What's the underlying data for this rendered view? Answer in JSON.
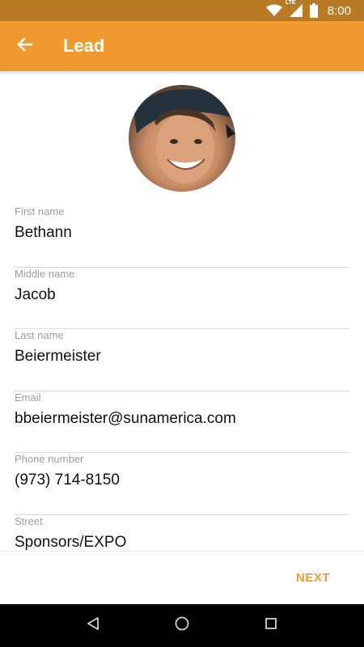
{
  "status_bar": {
    "time": "8:00",
    "network_label": "LTE",
    "icons": [
      "wifi-icon",
      "signal-icon",
      "battery-icon"
    ]
  },
  "app_bar": {
    "title": "Lead",
    "back_icon": "arrow-back-icon"
  },
  "avatar": {
    "icon": "profile-photo"
  },
  "fields": [
    {
      "label": "First name",
      "value": "Bethann"
    },
    {
      "label": "Middle name",
      "value": "Jacob"
    },
    {
      "label": "Last name",
      "value": "Beiermeister"
    },
    {
      "label": "Email",
      "value": "bbeiermeister@sunamerica.com"
    },
    {
      "label": "Phone number",
      "value": "(973) 714-8150"
    },
    {
      "label": "Street",
      "value": "Sponsors/EXPO"
    }
  ],
  "actions": {
    "next_label": "NEXT"
  },
  "nav_bar": {
    "icons": [
      "back-triangle-icon",
      "home-circle-icon",
      "recents-square-icon"
    ]
  },
  "colors": {
    "status_bar": "#b87a24",
    "app_bar": "#ef9a2e",
    "accent": "#ef9a2e",
    "divider": "#d9d9d9",
    "label": "#9e9e9e"
  }
}
